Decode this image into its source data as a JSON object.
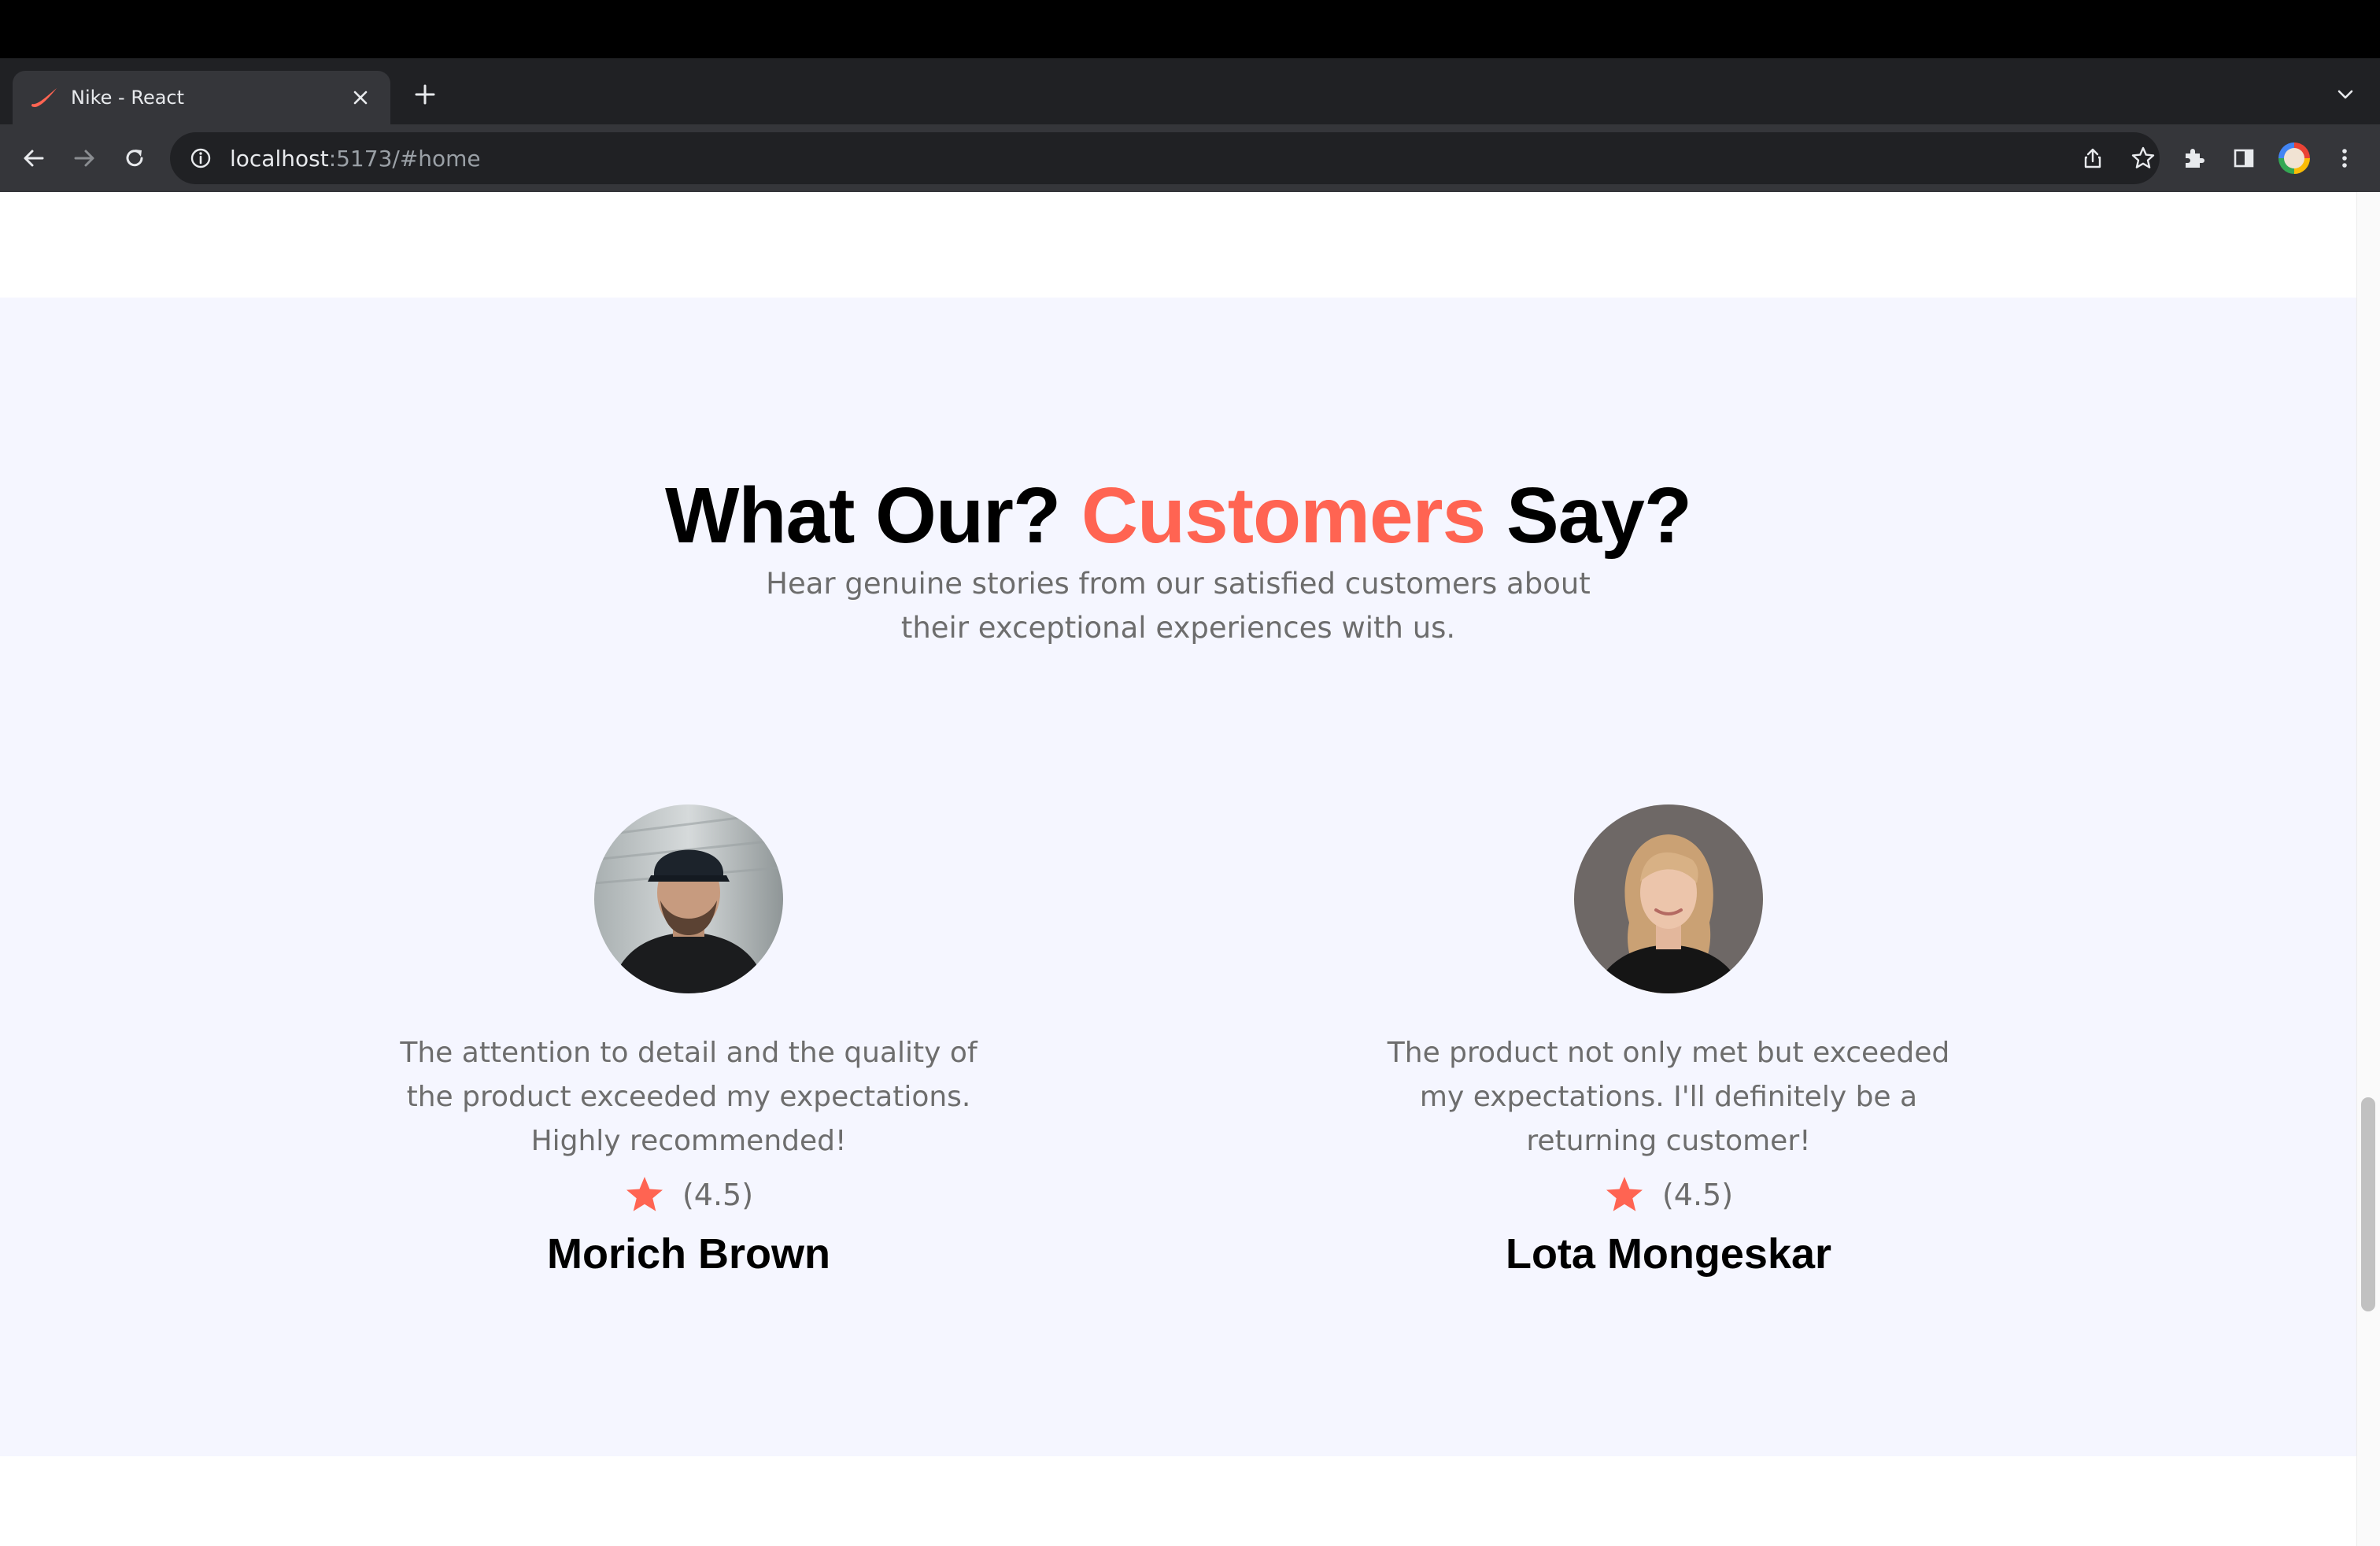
{
  "browser": {
    "tab": {
      "title": "Nike - React"
    },
    "address": {
      "host": "localhost",
      "rest": ":5173/#home"
    }
  },
  "colors": {
    "accent": "#ff6452",
    "section_background": "#f5f6ff",
    "body_text": "#6d6d6d"
  },
  "testimonials": {
    "heading": {
      "prefix": "What Our? ",
      "highlight": "Customers",
      "suffix": " Say?"
    },
    "subheading": "Hear genuine stories from our satisfied customers about their exceptional experiences with us.",
    "reviews": [
      {
        "quote": "The attention to detail and the quality of the product exceeded my expectations. Highly recommended!",
        "rating_text": "(4.5)",
        "name": "Morich Brown",
        "icon": "star-icon"
      },
      {
        "quote": "The product not only met but exceeded my expectations. I'll definitely be a returning customer!",
        "rating_text": "(4.5)",
        "name": "Lota Mongeskar",
        "icon": "star-icon"
      }
    ]
  }
}
